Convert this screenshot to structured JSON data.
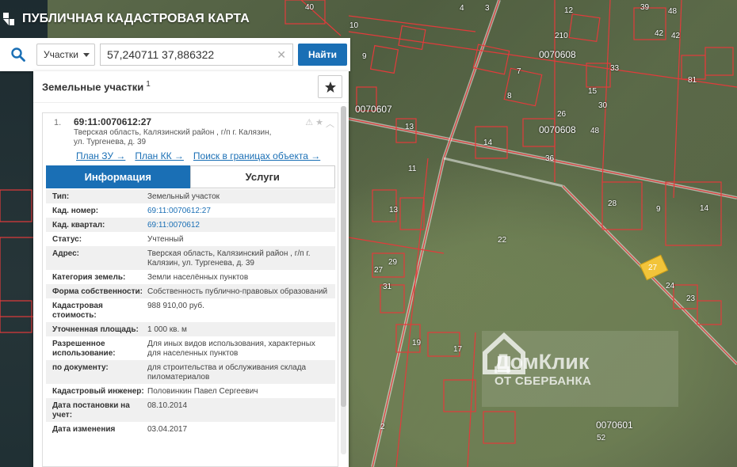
{
  "app": {
    "title": "ПУБЛИЧНАЯ КАДАСТРОВАЯ КАРТА"
  },
  "search": {
    "type_label": "Участки",
    "query": "57,240711 37,886322",
    "find_label": "Найти"
  },
  "panel": {
    "title": "Земельные участки",
    "count": "1",
    "item": {
      "index": "1.",
      "cad_number": "69:11:0070612:27",
      "address": "Тверская область, Калязинский район , г/п г. Калязин, ул. Тургенева, д. 39",
      "links": [
        "План ЗУ →",
        "План КК →",
        "Поиск в границах объекта →"
      ]
    },
    "tabs": [
      "Информация",
      "Услуги"
    ],
    "rows": [
      {
        "label": "Тип:",
        "value": "Земельный участок",
        "link": false
      },
      {
        "label": "Кад. номер:",
        "value": "69:11:0070612:27",
        "link": true
      },
      {
        "label": "Кад. квартал:",
        "value": "69:11:0070612",
        "link": true
      },
      {
        "label": "Статус:",
        "value": "Учтенный",
        "link": false
      },
      {
        "label": "Адрес:",
        "value": "Тверская область, Калязинский район , г/п г. Калязин, ул. Тургенева, д. 39",
        "link": false
      },
      {
        "label": "Категория земель:",
        "value": "Земли населённых пунктов",
        "link": false
      },
      {
        "label": "Форма собственности:",
        "value": "Собственность публично-правовых образований",
        "link": false
      },
      {
        "label": "Кадастровая стоимость:",
        "value": "988 910,00 руб.",
        "link": false
      },
      {
        "label": "Уточненная площадь:",
        "value": "1 000 кв. м",
        "link": false
      },
      {
        "label": "Разрешенное использование:",
        "value": "Для иных видов использования, характерных для населенных пунктов",
        "link": false
      },
      {
        "label": "по документу:",
        "value": "для строительства и обслуживания склада пиломатериалов",
        "link": false
      },
      {
        "label": "Кадастровый инженер:",
        "value": "Половинкин Павел Сергеевич",
        "link": false
      },
      {
        "label": "Дата постановки на учет:",
        "value": "08.10.2014",
        "link": false
      },
      {
        "label": "Дата изменения",
        "value": "03.04.2017",
        "link": false
      }
    ]
  },
  "map": {
    "quarters": [
      "0070608",
      "0070607",
      "0070608",
      "0070601"
    ],
    "plot_numbers": [
      "40",
      "10",
      "9",
      "3",
      "4",
      "12",
      "39",
      "42",
      "42",
      "48",
      "33",
      "81",
      "210",
      "7",
      "8",
      "15",
      "26",
      "30",
      "48",
      "36",
      "13",
      "14",
      "11",
      "13",
      "28",
      "9",
      "14",
      "22",
      "27",
      "24",
      "23",
      "29",
      "31",
      "19",
      "17",
      "52",
      "2"
    ],
    "highlight_plot": "27",
    "watermark_title": "ДомКлик",
    "watermark_sub": "ОТ СБЕРБАНКА"
  },
  "colors": {
    "accent": "#1a6fb5",
    "boundary": "#e23b3b",
    "highlight": "#f2c43a"
  }
}
